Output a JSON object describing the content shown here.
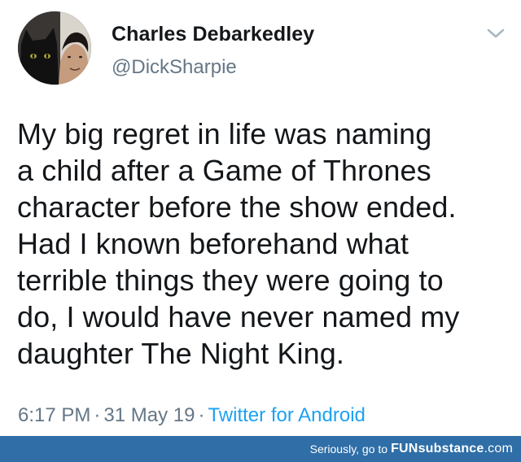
{
  "user": {
    "display_name": "Charles Debarkedley",
    "handle": "@DickSharpie"
  },
  "icons": {
    "caret": "chevron-down-icon"
  },
  "tweet": {
    "lines": [
      "My big regret in life was naming",
      "a child after a Game of Thrones",
      "character before the show ended.",
      "Had I known beforehand what",
      "terrible things they were going to",
      "do, I would have never named my",
      "daughter The Night King."
    ]
  },
  "meta": {
    "time": "6:17 PM",
    "separator": "·",
    "date": "31 May 19",
    "source": "Twitter for Android"
  },
  "footer": {
    "prefix": "Seriously, go to",
    "brand_part1": "FUN",
    "brand_part2": "substance",
    "brand_domain": ".com",
    "background": "#2f6ea7"
  },
  "colors": {
    "text": "#14171a",
    "secondary": "#657786",
    "link": "#1da1f2"
  }
}
